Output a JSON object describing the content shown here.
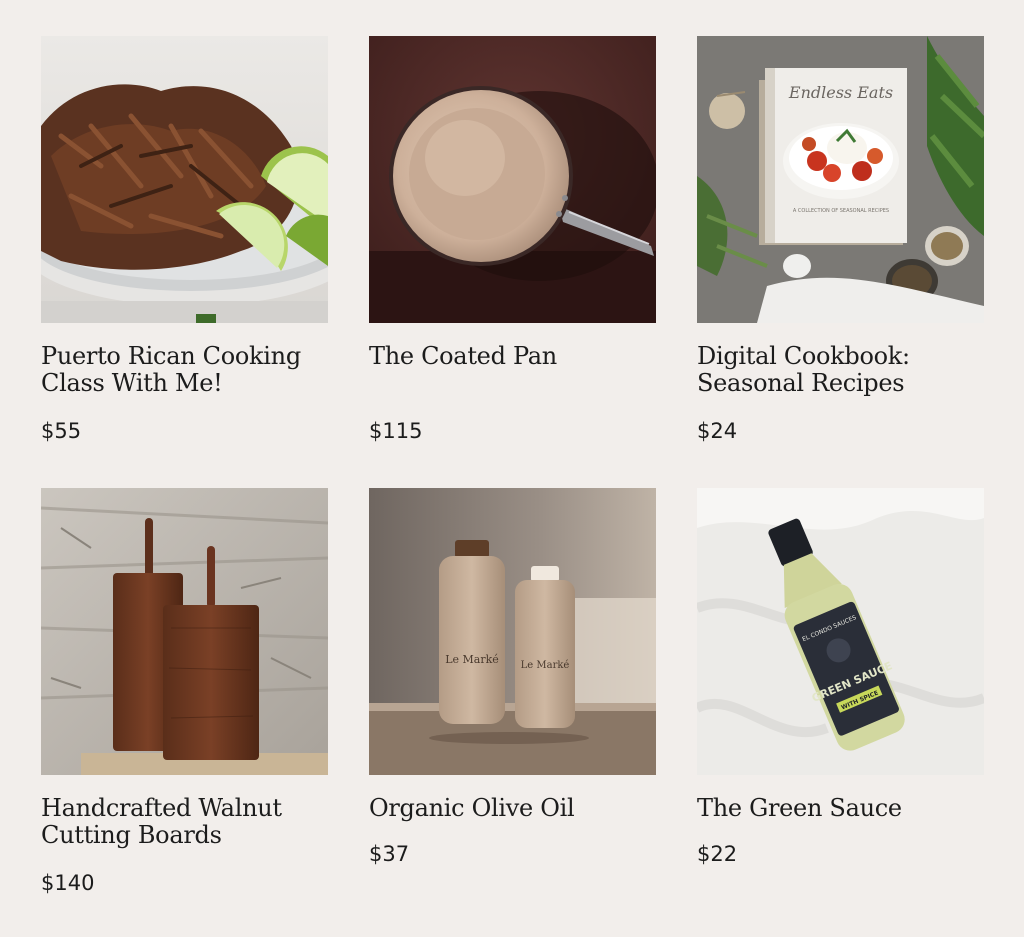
{
  "products": [
    {
      "title": "Puerto Rican Cooking Class With Me!",
      "price": "$55",
      "image": "shredded-pork-plate-image"
    },
    {
      "title": "The Coated Pan",
      "price": "$115",
      "image": "coated-pan-image"
    },
    {
      "title": "Digital Cookbook: Seasonal Recipes",
      "price": "$24",
      "image": "cookbook-image"
    },
    {
      "title": "Handcrafted Walnut Cutting Boards",
      "price": "$140",
      "image": "cutting-boards-image"
    },
    {
      "title": "Organic Olive Oil",
      "price": "$37",
      "image": "olive-oil-bottles-image"
    },
    {
      "title": "The Green Sauce",
      "price": "$22",
      "image": "green-sauce-bottle-image"
    }
  ],
  "image_text": {
    "cookbook_cover": "Endless Eats",
    "cookbook_subtitle": "A COLLECTION OF SEASONAL RECIPES",
    "bottle_brand": "Le Marké",
    "sauce_brand": "EL CONDO SAUCES",
    "sauce_name": "GREEN SAUCE",
    "sauce_tag": "WITH SPICE"
  },
  "colors": {
    "background": "#f2eeeb",
    "text": "#1c1c1c"
  }
}
